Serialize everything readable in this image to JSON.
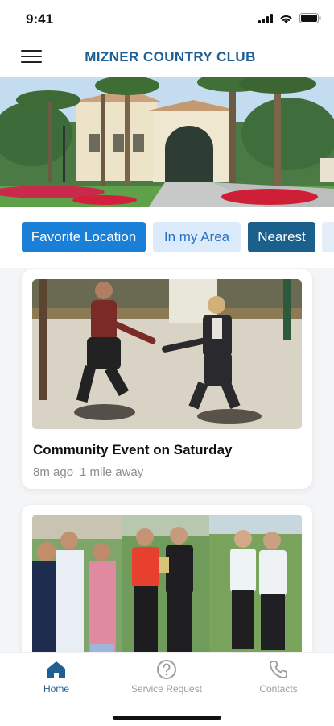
{
  "status_bar": {
    "time": "9:41"
  },
  "header": {
    "title": "MIZNER COUNTRY CLUB",
    "menu_icon": "hamburger-menu-icon"
  },
  "filters": [
    {
      "label": "Favorite Location",
      "state": "selected"
    },
    {
      "label": "In my Area",
      "state": "light"
    },
    {
      "label": "Nearest",
      "state": "dark"
    }
  ],
  "events": [
    {
      "title": "Community Event on Saturday",
      "time_ago": "8m ago",
      "distance": "1 mile away"
    }
  ],
  "tabs": [
    {
      "label": "Home",
      "icon": "home-icon",
      "active": true
    },
    {
      "label": "Service Request",
      "icon": "help-circle-icon",
      "active": false
    },
    {
      "label": "Contacts",
      "icon": "phone-icon",
      "active": false
    }
  ],
  "colors": {
    "brand_blue": "#1f5f93",
    "chip_selected": "#1a7fd6",
    "chip_light": "#dcebfb",
    "chip_dark": "#1b5f8c"
  }
}
